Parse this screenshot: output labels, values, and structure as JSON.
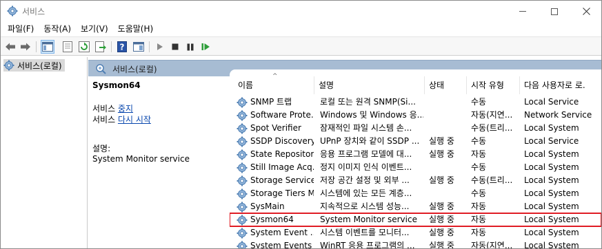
{
  "window": {
    "title": "서비스",
    "controls": {
      "minimize": "minimize-icon",
      "maximize": "maximize-icon",
      "close": "close-icon"
    }
  },
  "menu": [
    "파일(F)",
    "동작(A)",
    "보기(V)",
    "도움말(H)"
  ],
  "toolbar": {
    "icons": [
      "back-arrow-icon",
      "forward-arrow-icon",
      "console-tree-icon",
      "properties-icon",
      "refresh-icon",
      "export-icon",
      "help-icon",
      "show-hide-icon",
      "play-icon",
      "stop-icon",
      "pause-icon",
      "resume-icon"
    ]
  },
  "tree": {
    "root_label": "서비스(로컬)"
  },
  "panel": {
    "header_label": "서비스(로컬)",
    "selected_service": "Sysmon64",
    "actions": [
      {
        "prefix": "서비스 ",
        "link": "중지"
      },
      {
        "prefix": "서비스 ",
        "link": "다시 시작"
      }
    ],
    "description_label": "설명:",
    "description": "System Monitor service"
  },
  "list": {
    "columns": [
      "이름",
      "설명",
      "상태",
      "시작 유형",
      "다음 사용자로 로."
    ],
    "rows": [
      {
        "name": "SNMP 트랩",
        "desc": "로컬 또는 원격 SNMP(Si...",
        "status": "",
        "startup": "수동",
        "logon": "Local Service"
      },
      {
        "name": "Software Prote...",
        "desc": "Windows 및 Windows 응...",
        "status": "",
        "startup": "자동(지연...",
        "logon": "Network Service"
      },
      {
        "name": "Spot Verifier",
        "desc": "잠재적인 파일 시스템 손...",
        "status": "",
        "startup": "수동(트리...",
        "logon": "Local System"
      },
      {
        "name": "SSDP Discovery",
        "desc": "UPnP 장치와 같이 SSDP ...",
        "status": "실행 중",
        "startup": "수동",
        "logon": "Local Service"
      },
      {
        "name": "State Repositor...",
        "desc": "응용 프로그램 모델에 대...",
        "status": "실행 중",
        "startup": "자동",
        "logon": "Local System"
      },
      {
        "name": "Still Image Acq...",
        "desc": "정지 이미지 인식 이벤트...",
        "status": "",
        "startup": "수동",
        "logon": "Local System"
      },
      {
        "name": "Storage Service",
        "desc": "저장 공간 설정 및 외부 ...",
        "status": "실행 중",
        "startup": "수동(트리...",
        "logon": "Local System"
      },
      {
        "name": "Storage Tiers M...",
        "desc": "시스템에 있는 모든 계층...",
        "status": "",
        "startup": "수동",
        "logon": "Local System"
      },
      {
        "name": "SysMain",
        "desc": "지속적으로 시스템 성능...",
        "status": "실행 중",
        "startup": "자동",
        "logon": "Local System"
      },
      {
        "name": "Sysmon64",
        "desc": "System Monitor service",
        "status": "실행 중",
        "startup": "자동",
        "logon": "Local System",
        "highlight": true
      },
      {
        "name": "System Event ...",
        "desc": "시스템 이벤트를 모니터...",
        "status": "실행 중",
        "startup": "자동",
        "logon": "Local System"
      },
      {
        "name": "System Events ...",
        "desc": "WinRT 응용 프로그램의 ...",
        "status": "실행 중",
        "startup": "자동(지연...",
        "logon": "Local System"
      }
    ]
  },
  "colors": {
    "panel_header": "#a7bcd3",
    "highlight_border": "#e01b24",
    "link": "#0645ad",
    "tree_selected": "#d9d9d9"
  }
}
